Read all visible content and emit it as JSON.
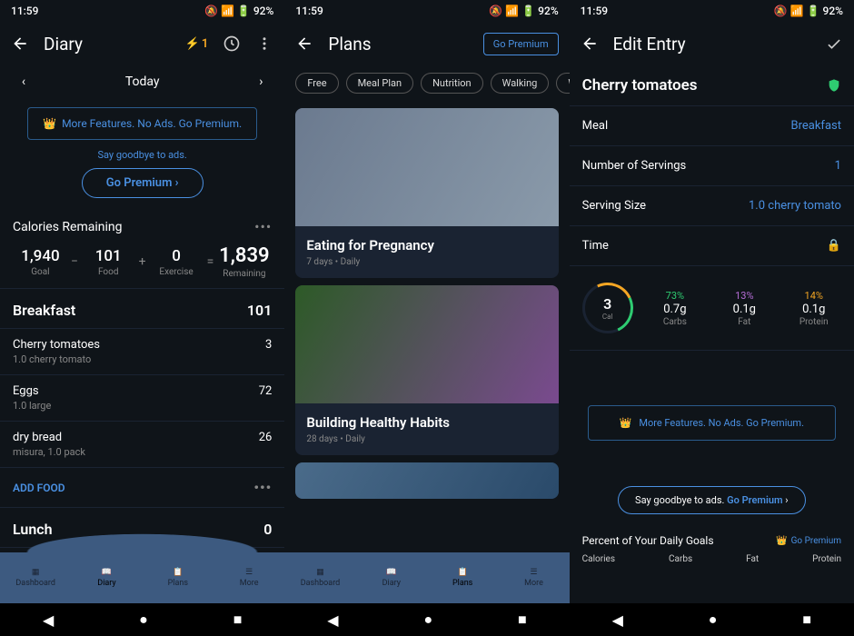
{
  "status": {
    "time": "11:59",
    "battery": "92%",
    "silent": "🔕",
    "wifi": "▾◢",
    "bat_icon": "▮"
  },
  "p1": {
    "title": "Diary",
    "streak": "1",
    "date": "Today",
    "promo_text": "More Features. No Ads. Go Premium.",
    "promo_sub": "Say goodbye to ads.",
    "premium_btn": "Go Premium",
    "calories_label": "Calories Remaining",
    "goal": {
      "n": "1,940",
      "l": "Goal"
    },
    "food": {
      "n": "101",
      "l": "Food"
    },
    "exercise": {
      "n": "0",
      "l": "Exercise"
    },
    "remaining": {
      "n": "1,839",
      "l": "Remaining"
    },
    "breakfast": {
      "label": "Breakfast",
      "total": "101"
    },
    "items": [
      {
        "name": "Cherry tomatoes",
        "desc": "1.0 cherry tomato",
        "cal": "3"
      },
      {
        "name": "Eggs",
        "desc": "1.0 large",
        "cal": "72"
      },
      {
        "name": "dry bread",
        "desc": "misura, 1.0 pack",
        "cal": "26"
      }
    ],
    "add_food": "ADD FOOD",
    "lunch": {
      "label": "Lunch",
      "total": "0"
    },
    "tabs": [
      "Dashboard",
      "Diary",
      "Plans",
      "More"
    ]
  },
  "p2": {
    "title": "Plans",
    "premium_btn": "Go Premium",
    "chips": [
      "Free",
      "Meal Plan",
      "Nutrition",
      "Walking",
      "Workout"
    ],
    "cards": [
      {
        "title": "Eating for Pregnancy",
        "meta": "7 days • Daily"
      },
      {
        "title": "Building Healthy Habits",
        "meta": "28 days • Daily"
      }
    ],
    "tabs": [
      "Dashboard",
      "Diary",
      "Plans",
      "More"
    ]
  },
  "p3": {
    "title": "Edit Entry",
    "food": "Cherry tomatoes",
    "rows": [
      {
        "k": "Meal",
        "v": "Breakfast"
      },
      {
        "k": "Number of Servings",
        "v": "1"
      },
      {
        "k": "Serving Size",
        "v": "1.0 cherry tomato"
      },
      {
        "k": "Time",
        "v": ""
      }
    ],
    "cal": {
      "n": "3",
      "l": "Cal"
    },
    "macros": [
      {
        "pct": "73%",
        "g": "0.7g",
        "l": "Carbs"
      },
      {
        "pct": "13%",
        "g": "0.1g",
        "l": "Fat"
      },
      {
        "pct": "14%",
        "g": "0.1g",
        "l": "Protein"
      }
    ],
    "promo_text": "More Features. No Ads. Go Premium.",
    "bottom_promo_a": "Say goodbye to ads. ",
    "bottom_promo_b": "Go Premium",
    "daily_goals": "Percent of Your Daily Goals",
    "go_premium": "Go Premium",
    "cols": [
      "Calories",
      "Carbs",
      "Fat",
      "Protein"
    ]
  }
}
